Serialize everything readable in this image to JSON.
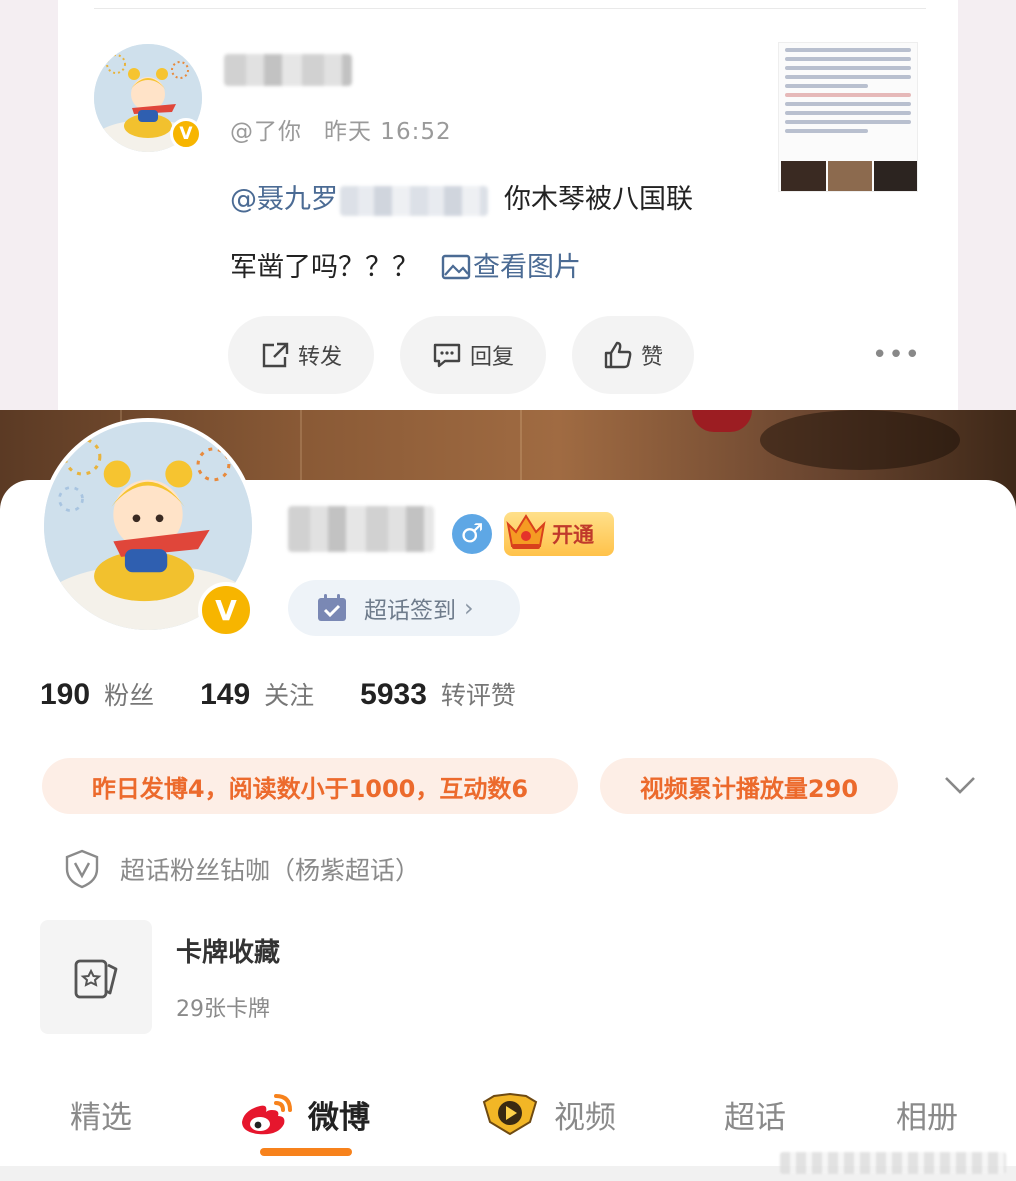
{
  "comment": {
    "meta_handle": "@了你",
    "meta_time": "昨天 16:52",
    "mention": "@聂九罗",
    "text_part1": "你木琴被八国联",
    "text_part2": "军凿了吗？？？",
    "view_image_label": "查看图片",
    "repost_label": "转发",
    "reply_label": "回复",
    "like_label": "赞",
    "more_label": "•••"
  },
  "profile": {
    "gender_symbol": "♂",
    "vip_label": "开通",
    "checkin_label": "超话签到",
    "checkin_chevron": "›",
    "verified_badge": "V",
    "stats": [
      {
        "value": "190",
        "label": "粉丝"
      },
      {
        "value": "149",
        "label": "关注"
      },
      {
        "value": "5933",
        "label": "转评赞"
      }
    ],
    "chip_daily": "昨日发博4，阅读数小于1000，互动数6",
    "chip_video": "视频累计播放量290",
    "supertopic_text": "超话粉丝钻咖（杨紫超话）",
    "card_title": "卡牌收藏",
    "card_count": "29张卡牌"
  },
  "tabs": {
    "featured": "精选",
    "weibo": "微博",
    "video": "视频",
    "supertopic": "超话",
    "album": "相册"
  },
  "colors": {
    "accent_orange": "#ec6a2c",
    "tab_underline": "#f7821c",
    "link_blue": "#4b6b94",
    "verified_gold": "#f7b500",
    "gender_blue": "#5ea7e5"
  },
  "icons": [
    "repost-icon",
    "reply-icon",
    "like-icon",
    "image-icon",
    "calendar-check-icon",
    "shield-v-icon",
    "card-icon",
    "weibo-logo-icon",
    "video-play-icon",
    "chevron-down-icon",
    "crown-icon"
  ]
}
